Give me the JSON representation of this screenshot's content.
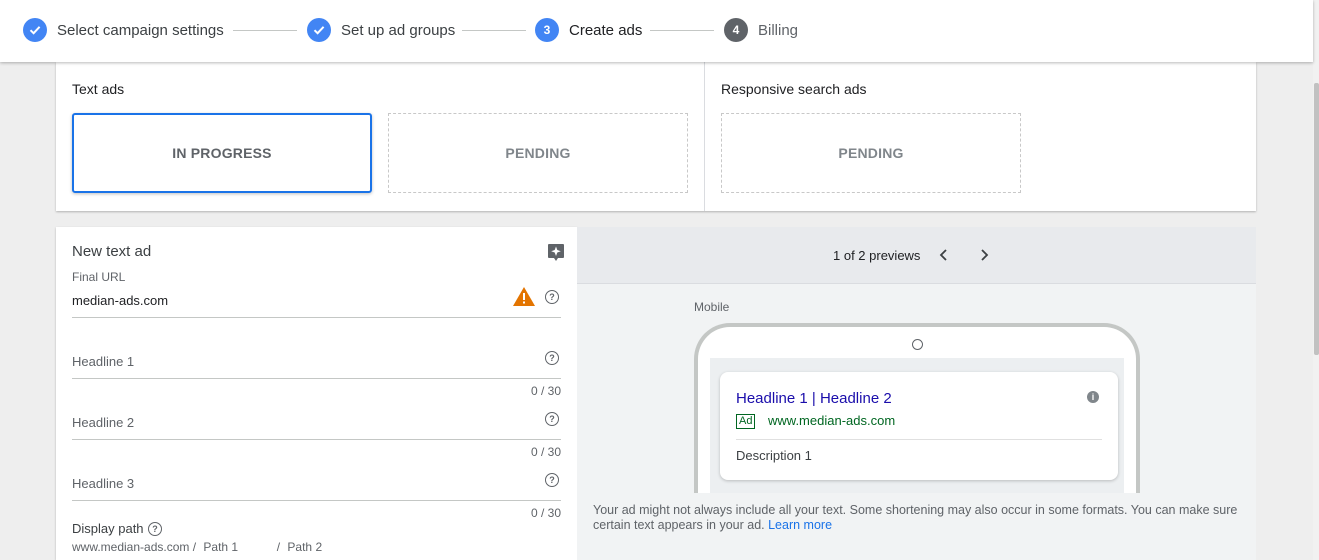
{
  "stepper": {
    "steps": [
      {
        "label": "Select campaign settings",
        "state": "done",
        "number": ""
      },
      {
        "label": "Set up ad groups",
        "state": "done",
        "number": ""
      },
      {
        "label": "Create ads",
        "state": "active",
        "number": "3"
      },
      {
        "label": "Billing",
        "state": "todo",
        "number": "4"
      }
    ]
  },
  "ad_types": {
    "text_ads": {
      "title": "Text ads",
      "boxes": [
        {
          "label": "IN PROGRESS",
          "state": "in-progress"
        },
        {
          "label": "PENDING",
          "state": "pending"
        }
      ]
    },
    "responsive_search_ads": {
      "title": "Responsive search ads",
      "boxes": [
        {
          "label": "PENDING",
          "state": "pending"
        }
      ]
    }
  },
  "editor": {
    "title": "New text ad",
    "final_url": {
      "label": "Final URL",
      "value": "median-ads.com"
    },
    "headlines": [
      {
        "placeholder": "Headline 1",
        "counter": "0 / 30"
      },
      {
        "placeholder": "Headline 2",
        "counter": "0 / 30"
      },
      {
        "placeholder": "Headline 3",
        "counter": "0 / 30"
      }
    ],
    "display_path": {
      "label": "Display path",
      "domain": "www.median-ads.com /",
      "path1": "Path 1",
      "separator": "/",
      "path2": "Path 2"
    }
  },
  "preview": {
    "count_text": "1 of 2 previews",
    "device_label": "Mobile",
    "ad": {
      "headline": "Headline 1 | Headline 2",
      "badge": "Ad",
      "url": "www.median-ads.com",
      "description": "Description 1"
    },
    "notice": "Your ad might not always include all your text. Some shortening may also occur in some formats. You can make sure certain text appears in your ad.",
    "learn_more": "Learn more"
  },
  "colors": {
    "accent": "#4285f4",
    "in_progress_border": "#1a73e8",
    "warning": "#e37400",
    "ad_headline": "#1a0dab",
    "ad_url": "#006621"
  }
}
